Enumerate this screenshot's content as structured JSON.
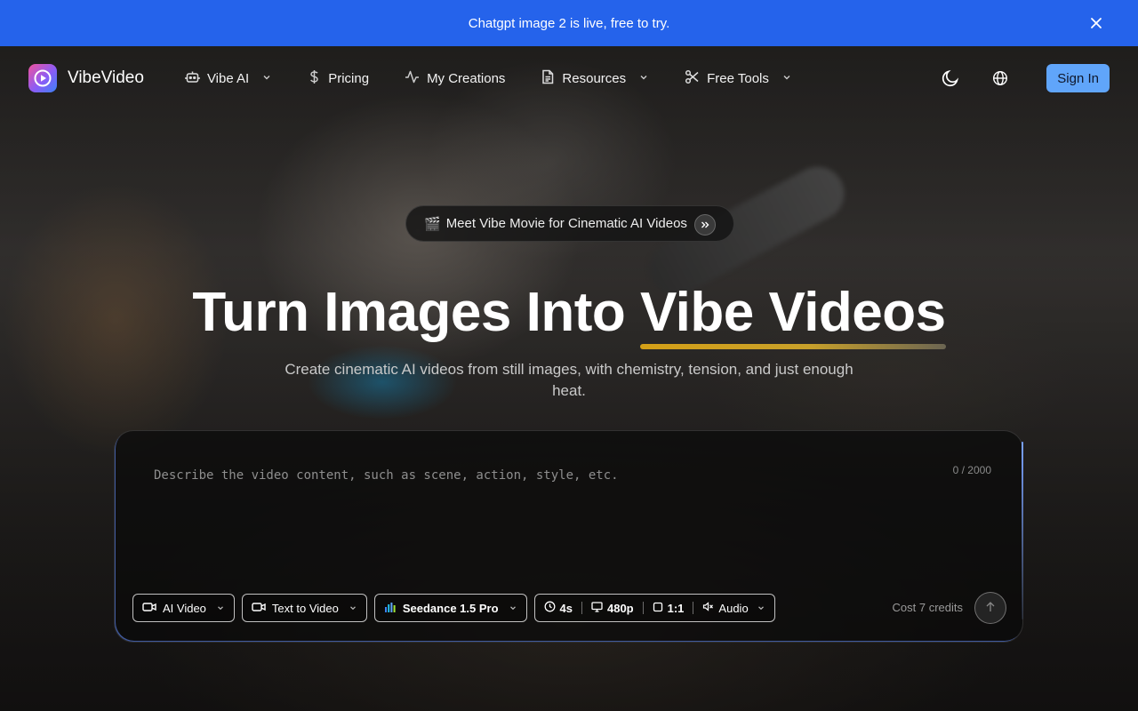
{
  "announcement": {
    "text": "Chatgpt image 2 is live, free to try."
  },
  "brand": {
    "name": "VibeVideo"
  },
  "nav": {
    "items": [
      {
        "label": "Vibe AI",
        "icon": "robot-icon",
        "dropdown": true
      },
      {
        "label": "Pricing",
        "icon": "dollar-icon",
        "dropdown": false
      },
      {
        "label": "My Creations",
        "icon": "activity-icon",
        "dropdown": false
      },
      {
        "label": "Resources",
        "icon": "document-icon",
        "dropdown": true
      },
      {
        "label": "Free Tools",
        "icon": "scissors-icon",
        "dropdown": true
      }
    ],
    "signin_label": "Sign In"
  },
  "hero": {
    "pill_emoji": "🎬",
    "pill_text": "Meet Vibe Movie for Cinematic AI Videos",
    "headline_start": "Turn Images Into ",
    "headline_highlight": "Vibe Videos",
    "subtitle": "Create cinematic AI videos from still images, with chemistry, tension, and just enough heat."
  },
  "prompt": {
    "placeholder": "Describe the video content, such as scene, action, style, etc.",
    "value": "",
    "counter": "0 / 2000",
    "mode": "AI Video",
    "type": "Text to Video",
    "model": "Seedance 1.5 Pro",
    "duration": "4s",
    "resolution": "480p",
    "aspect": "1:1",
    "audio": "Audio",
    "cost": "Cost 7 credits"
  },
  "colors": {
    "announcement_bg": "#2563eb",
    "signin_bg": "#60a5fa",
    "highlight_underline": "#d4a017"
  }
}
